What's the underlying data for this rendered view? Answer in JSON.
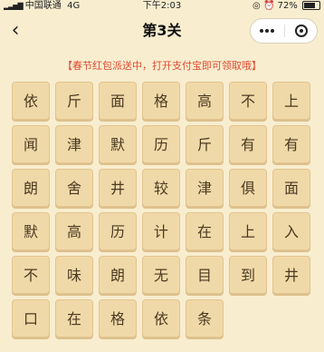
{
  "status_bar": {
    "carrier": "中国联通",
    "network": "4G",
    "time": "下午2:03",
    "battery": "72%",
    "battery_level": 0.72
  },
  "nav": {
    "back_icon": "chevron-left-icon",
    "title": "第3关",
    "more_icon": "more-dots-icon",
    "close_icon": "close-miniprogram-icon"
  },
  "notice": "【春节红包派送中，打开支付宝即可领取哦】",
  "grid": {
    "rows": [
      [
        "依",
        "斤",
        "面",
        "格",
        "高",
        "不",
        "上"
      ],
      [
        "闻",
        "津",
        "默",
        "历",
        "斤",
        "有",
        "有"
      ],
      [
        "朗",
        "舍",
        "井",
        "较",
        "津",
        "俱",
        "面"
      ],
      [
        "默",
        "高",
        "历",
        "计",
        "在",
        "上",
        "入"
      ],
      [
        "不",
        "味",
        "朗",
        "无",
        "目",
        "到",
        "井"
      ],
      [
        "口",
        "在",
        "格",
        "依",
        "条"
      ]
    ]
  }
}
